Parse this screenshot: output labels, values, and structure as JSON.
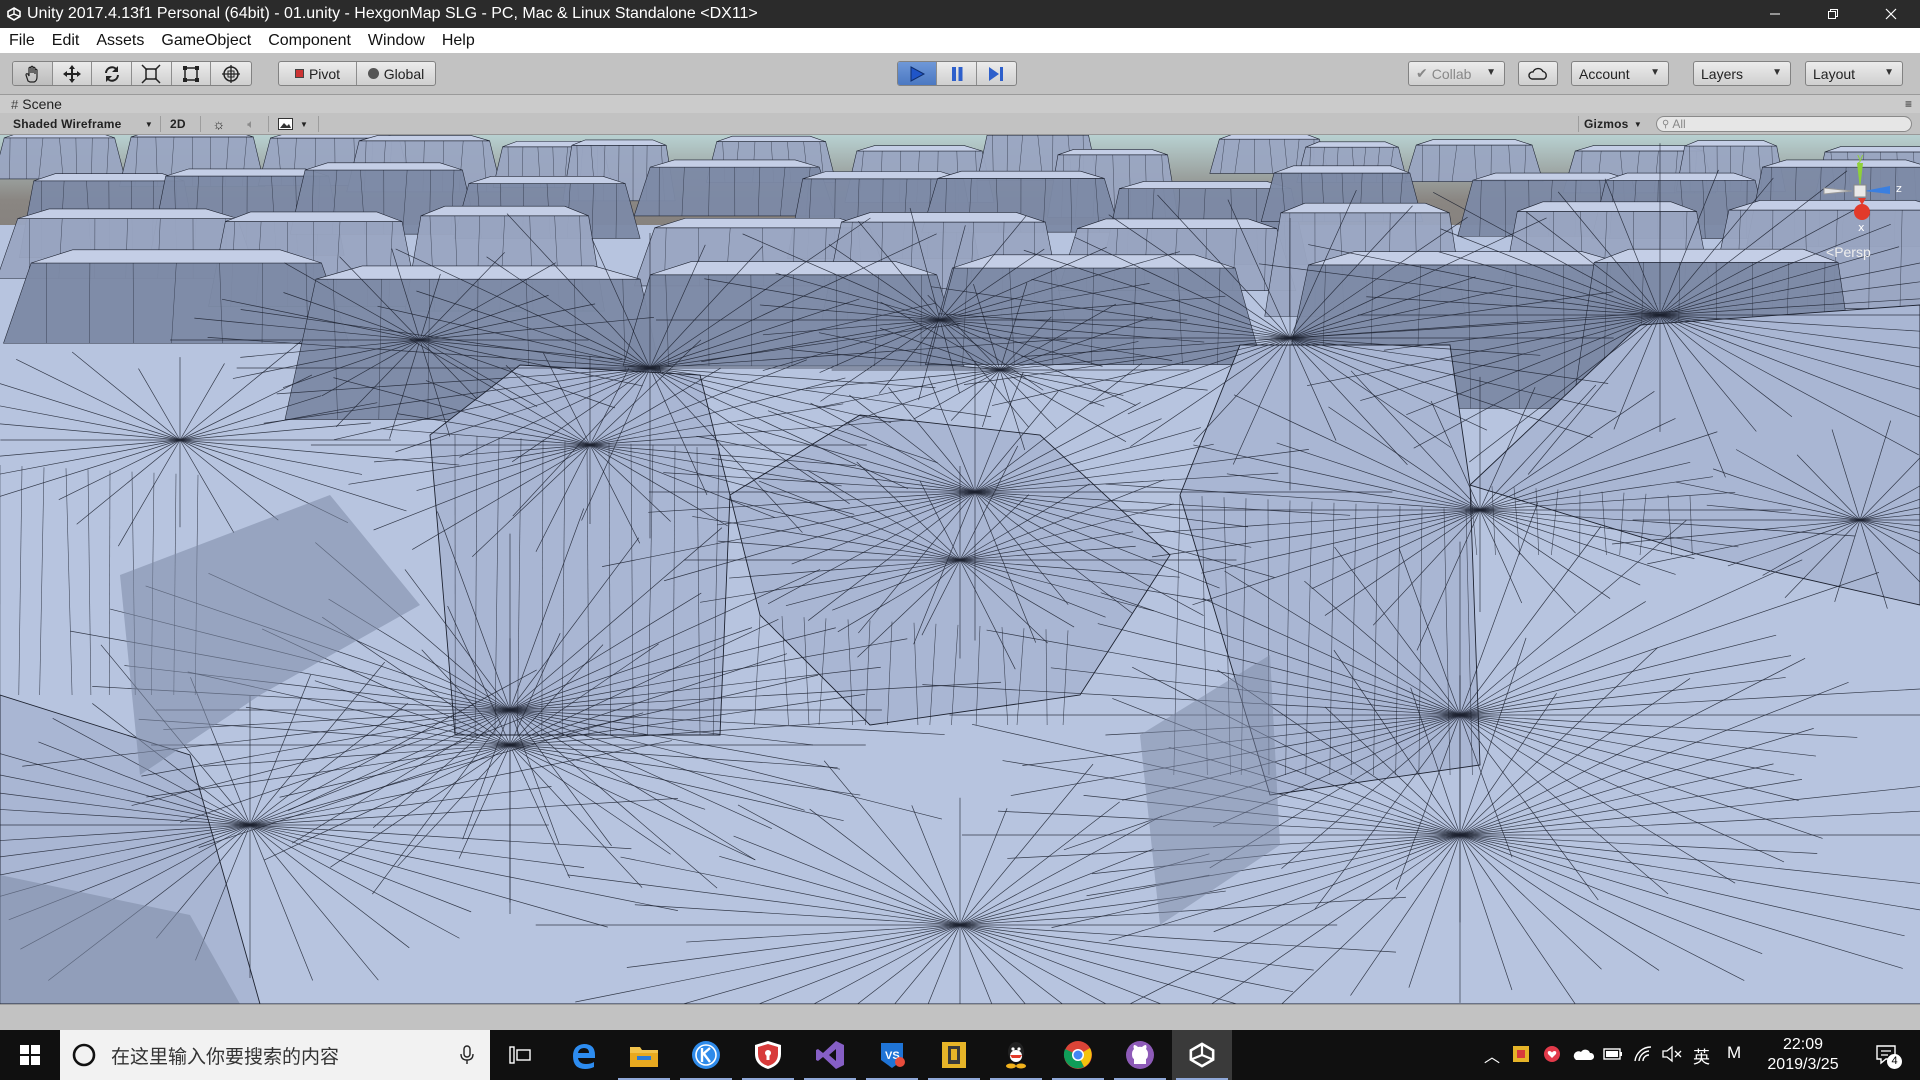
{
  "window": {
    "title": "Unity 2017.4.13f1 Personal (64bit) - 01.unity - HexgonMap SLG - PC, Mac & Linux Standalone <DX11>",
    "icons": [
      "unity-icon",
      "minimize-icon",
      "restore-icon",
      "close-icon"
    ]
  },
  "menu": [
    "File",
    "Edit",
    "Assets",
    "GameObject",
    "Component",
    "Window",
    "Help"
  ],
  "toolbar": {
    "tools": [
      "hand-tool-icon",
      "move-tool-icon",
      "rotate-tool-icon",
      "scale-tool-icon",
      "rect-tool-icon",
      "transform-tool-icon"
    ],
    "pivot": "Pivot",
    "global": "Global",
    "play_active": true,
    "collab": "Collab",
    "account": "Account",
    "layers": "Layers",
    "layout": "Layout"
  },
  "scene": {
    "tab": "Scene",
    "shading": "Shaded Wireframe",
    "mode2d": "2D",
    "gizmos": "Gizmos",
    "search_placeholder": "All",
    "persp": "Persp",
    "axis_y": "y",
    "axis_x": "x",
    "axis_z": "z",
    "colors": {
      "sky_top": "#b8d1d1",
      "horizon": "#6f6a67",
      "terrain": "#b7c4df",
      "shadow": "#7d8aa6",
      "wire": "#1d2230"
    }
  },
  "taskbar": {
    "search_placeholder": "在这里输入你要搜索的内容",
    "apps": [
      "task-view-icon",
      "edge-icon",
      "file-explorer-icon",
      "kugou-icon",
      "security-icon",
      "visual-studio-icon",
      "vsc-icon",
      "clipboard-app-icon",
      "qq-icon",
      "chrome-icon",
      "github-icon",
      "unity-icon"
    ],
    "ime": "英",
    "ime_mode": "M",
    "time": "22:09",
    "date": "2019/3/25",
    "notifications": "4"
  }
}
